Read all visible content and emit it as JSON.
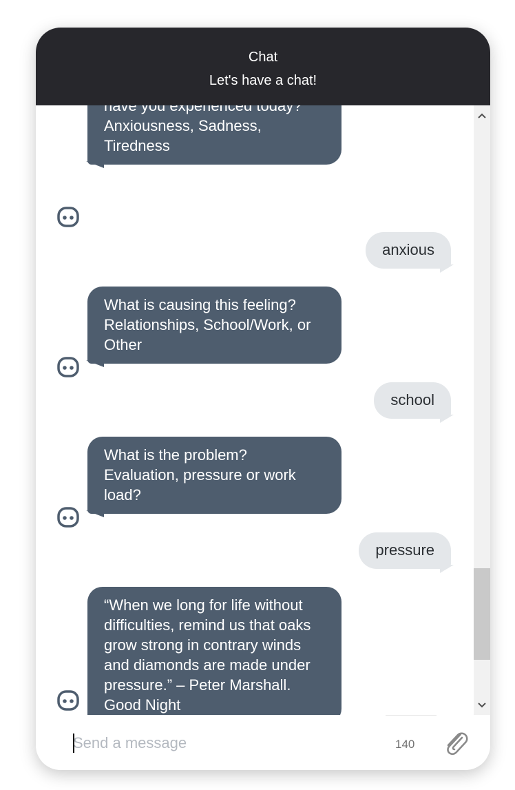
{
  "header": {
    "title": "Chat",
    "subtitle": "Let's have a chat!"
  },
  "messages": [
    {
      "sender": "bot",
      "text": "How many of these feelings have you experienced today? Anxiousness, Sadness, Tiredness"
    },
    {
      "sender": "user",
      "text": "anxious"
    },
    {
      "sender": "bot",
      "text": "What is causing this feeling? Relationships, School/Work, or Other"
    },
    {
      "sender": "user",
      "text": "school"
    },
    {
      "sender": "bot",
      "text": "What is the problem? Evaluation, pressure or work load?"
    },
    {
      "sender": "user",
      "text": "pressure"
    },
    {
      "sender": "bot",
      "text": "“When we long for life without difficulties, remind us that oaks grow strong in contrary winds and diamonds are made under pressure.” – Peter Marshall. Good Night"
    }
  ],
  "composer": {
    "placeholder": "Send a message",
    "char_limit": "140"
  },
  "icons": {
    "bot_avatar": "bot-face-icon",
    "attach": "paperclip-icon",
    "scroll_up": "chevron-up-icon",
    "scroll_down": "chevron-down-icon"
  },
  "colors": {
    "header_bg": "#27272c",
    "bot_bubble": "#4e5d6e",
    "user_bubble": "#e4e7ea"
  }
}
